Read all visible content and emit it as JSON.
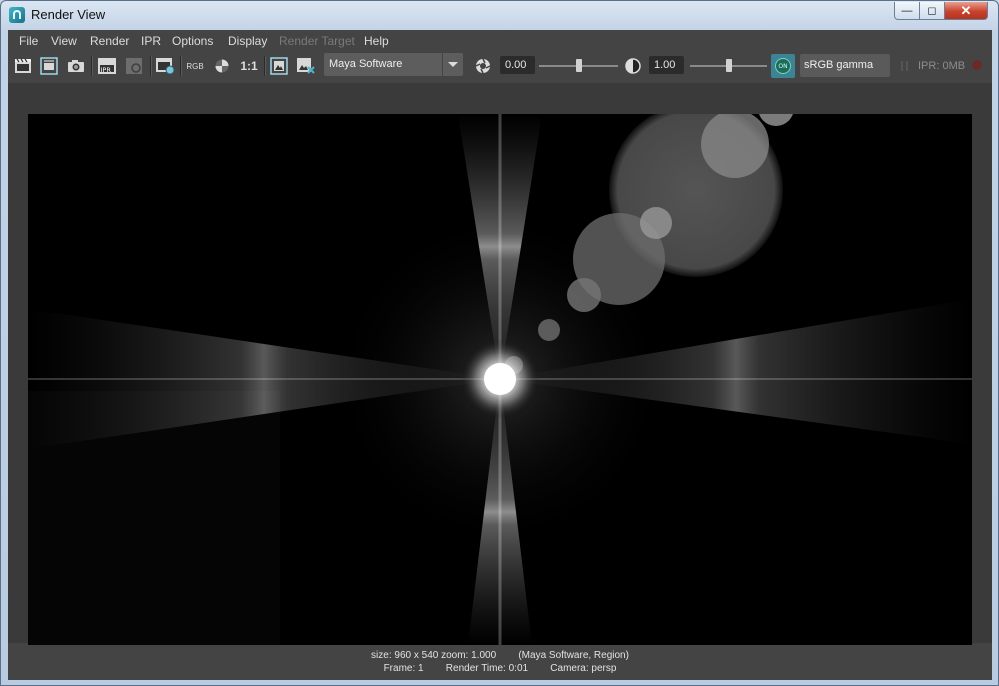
{
  "window": {
    "title": "Render View"
  },
  "menu": [
    "File",
    "View",
    "Render",
    "IPR",
    "Options",
    "Display",
    "Render Target",
    "Help"
  ],
  "menu_disabled": [
    "Render Target"
  ],
  "toolbar": {
    "icons": [
      "render-frame-icon",
      "render-region-icon",
      "snapshot-icon",
      "ipr-render-icon",
      "ipr-refresh-icon",
      "render-settings-icon",
      "rgb-channel-icon",
      "alpha-channel-icon",
      "real-size-icon",
      "keep-image-icon",
      "remove-image-icon",
      "exposure-icon",
      "gamma-icon"
    ],
    "rgb_label": "RGB",
    "real_size_label": "1:1",
    "ipr_label": "IPR",
    "renderer": "Maya Software",
    "exposure_value": "0.00",
    "exposure_level": 0.5,
    "gamma_value": "1.00",
    "gamma_level": 0.5,
    "color_management_toggle": "ON",
    "view_transform": "sRGB gamma",
    "ipr_memory": "IPR: 0MB"
  },
  "status": {
    "line1": "size: 960 x 540 zoom: 1.000        (Maya Software, Region)",
    "line2": "Frame: 1        Render Time: 0:01        Camera: persp"
  },
  "colors": {
    "title_bg": "#c9d6e6",
    "panel_bg": "#444444",
    "accent": "#3c8396",
    "close_button": "#c9432c"
  }
}
